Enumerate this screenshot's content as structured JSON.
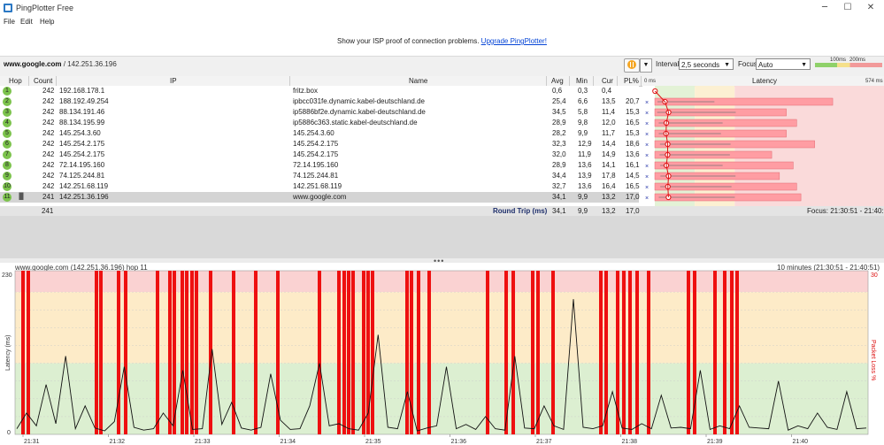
{
  "window": {
    "title": "PingPlotter Free",
    "minimize": "─",
    "maximize": "☐",
    "close": "✕"
  },
  "menu": [
    "File",
    "Edit",
    "Help"
  ],
  "promo": {
    "text": "Show your ISP proof of connection problems.",
    "link": "Upgrade PingPlotter!"
  },
  "target": {
    "host": "www.google.com",
    "ip": " / 142.251.36.196"
  },
  "controls": {
    "interval_label": "Interval",
    "interval_value": "2,5 seconds",
    "focus_label": "Focus",
    "focus_value": "Auto",
    "scale_100": "100ms",
    "scale_200": "200ms"
  },
  "table": {
    "headers": {
      "hop": "Hop",
      "count": "Count",
      "ip": "IP",
      "name": "Name",
      "avg": "Avg",
      "min": "Min",
      "cur": "Cur",
      "pl": "PL%",
      "latency": "Latency"
    },
    "latency_min": "0 ms",
    "latency_max": "574 ms",
    "rows": [
      {
        "hop": "1",
        "count": "242",
        "ip": "192.168.178.1",
        "name": "fritz.box",
        "avg": "0,6",
        "min": "0,3",
        "cur": "0,4",
        "pl": ""
      },
      {
        "hop": "2",
        "count": "242",
        "ip": "188.192.49.254",
        "name": "ipbcc031fe.dynamic.kabel-deutschland.de",
        "avg": "25,4",
        "min": "6,6",
        "cur": "13,5",
        "pl": "20,7"
      },
      {
        "hop": "3",
        "count": "242",
        "ip": "88.134.191.46",
        "name": "ip5886bf2e.dynamic.kabel-deutschland.de",
        "avg": "34,5",
        "min": "5,8",
        "cur": "11,4",
        "pl": "15,3"
      },
      {
        "hop": "4",
        "count": "242",
        "ip": "88.134.195.99",
        "name": "ip5886c363.static.kabel-deutschland.de",
        "avg": "28,9",
        "min": "9,8",
        "cur": "12,0",
        "pl": "16,5"
      },
      {
        "hop": "5",
        "count": "242",
        "ip": "145.254.3.60",
        "name": "145.254.3.60",
        "avg": "28,2",
        "min": "9,9",
        "cur": "11,7",
        "pl": "15,3"
      },
      {
        "hop": "6",
        "count": "242",
        "ip": "145.254.2.175",
        "name": "145.254.2.175",
        "avg": "32,3",
        "min": "12,9",
        "cur": "14,4",
        "pl": "18,6"
      },
      {
        "hop": "7",
        "count": "242",
        "ip": "145.254.2.175",
        "name": "145.254.2.175",
        "avg": "32,0",
        "min": "11,9",
        "cur": "14,9",
        "pl": "13,6"
      },
      {
        "hop": "8",
        "count": "242",
        "ip": "72.14.195.160",
        "name": "72.14.195.160",
        "avg": "28,9",
        "min": "13,6",
        "cur": "14,1",
        "pl": "16,1"
      },
      {
        "hop": "9",
        "count": "242",
        "ip": "74.125.244.81",
        "name": "74.125.244.81",
        "avg": "34,4",
        "min": "13,9",
        "cur": "17,8",
        "pl": "14,5"
      },
      {
        "hop": "10",
        "count": "242",
        "ip": "142.251.68.119",
        "name": "142.251.68.119",
        "avg": "32,7",
        "min": "13,6",
        "cur": "16,4",
        "pl": "16,5"
      },
      {
        "hop": "11",
        "count": "241",
        "ip": "142.251.36.196",
        "name": "www.google.com",
        "avg": "34,1",
        "min": "9,9",
        "cur": "13,2",
        "pl": "17,0"
      }
    ],
    "roundtrip": {
      "count": "241",
      "label": "Round Trip (ms)",
      "avg": "34,1",
      "min": "9,9",
      "cur": "13,2",
      "pl": "17,0"
    },
    "focus_range": "Focus: 21:30:51 - 21:40:51"
  },
  "graph": {
    "title": "www.google.com (142.251.36.196) hop 11",
    "range": "10 minutes (21:30:51 - 21:40:51)",
    "y_max": "230",
    "y_min": "0",
    "right_max": "30",
    "y_axis_label": "Latency (ms)",
    "right_axis_label": "Packet Loss %",
    "time_labels": [
      "21:31",
      "21:32",
      "21:33",
      "21:34",
      "21:35",
      "21:36",
      "21:37",
      "21:38",
      "21:39",
      "21:40"
    ]
  },
  "chart_data": {
    "type": "line",
    "y_range_ms": [
      0,
      230
    ],
    "packet_loss_range_pct": [
      0,
      30
    ],
    "x_labels": [
      "21:31",
      "21:32",
      "21:33",
      "21:34",
      "21:35",
      "21:36",
      "21:37",
      "21:38",
      "21:39",
      "21:40"
    ],
    "packet_loss_at": [
      "21:31",
      "21:32",
      "21:33",
      "21:34",
      "21:35",
      "21:36",
      "21:37",
      "21:38",
      "21:39"
    ],
    "latency_sample_ms": [
      8,
      30,
      12,
      70,
      15,
      110,
      8,
      40,
      9,
      5,
      18,
      95,
      10,
      6,
      8,
      30,
      12,
      90,
      7,
      8,
      120,
      14,
      45,
      9,
      6,
      10,
      85,
      20,
      7,
      8,
      40,
      100,
      12,
      15,
      8,
      6,
      30,
      140,
      10,
      8,
      60,
      5,
      9,
      12,
      95,
      8,
      14,
      7,
      25,
      8,
      6,
      110,
      9,
      8,
      40,
      12,
      7,
      190,
      10,
      8,
      12,
      60,
      9,
      7,
      15,
      8,
      55,
      9,
      10,
      8,
      90,
      7,
      12,
      8,
      40,
      10,
      9,
      8,
      75,
      6,
      12,
      8,
      30,
      10,
      7,
      60,
      8,
      9
    ]
  }
}
